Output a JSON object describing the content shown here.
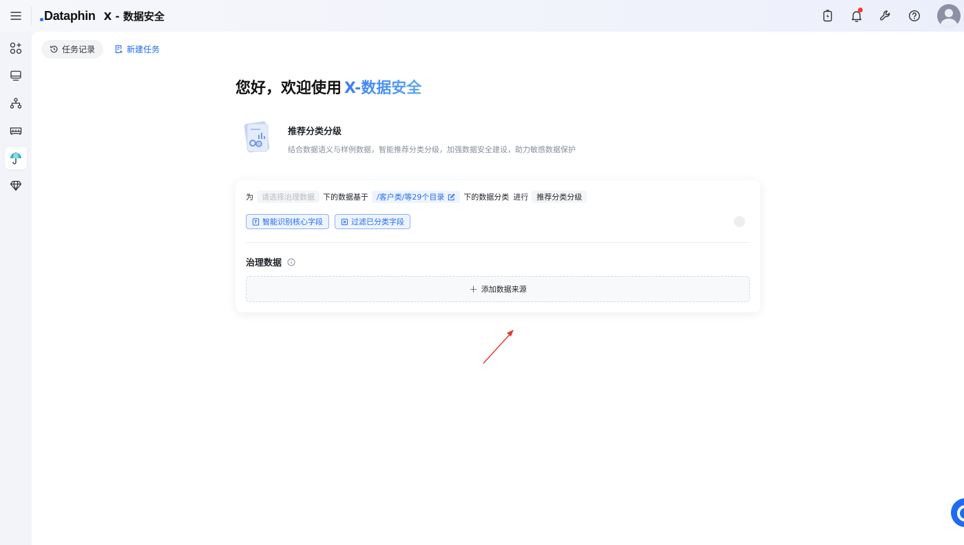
{
  "header": {
    "logo_text": "Dataphin",
    "app_title": "X - 数据安全",
    "icons": [
      "battery-charge-icon",
      "bell-icon",
      "wrench-icon",
      "help-icon",
      "avatar"
    ]
  },
  "sidebar": {
    "items": [
      "apps-icon",
      "monitor-icon",
      "hierarchy-icon",
      "dashboard-icon",
      "umbrella-icon",
      "diamond-icon"
    ],
    "active": "umbrella-icon"
  },
  "tabs": {
    "history_label": "任务记录",
    "new_task_label": "新建任务"
  },
  "welcome": {
    "prefix": "您好，欢迎使用",
    "brand": "X-数据安全"
  },
  "feature": {
    "title": "推荐分类分级",
    "description": "结合数据语义与样例数据，智能推荐分类分级，加强数据安全建设，助力敏感数据保护"
  },
  "prompt": {
    "word_for": "为",
    "data_placeholder": "请选择治理数据",
    "word_based_on": "下的数据基于",
    "catalog_path": "/客户类/等29个目录",
    "word_classification": "下的数据分类",
    "word_perform": "进行",
    "action": "推荐分类分级"
  },
  "options": {
    "identify_core": "智能识别核心字段",
    "filter_classified": "过滤已分类字段"
  },
  "governance": {
    "section_title": "治理数据",
    "add_source_label": "添加数据来源"
  },
  "colors": {
    "accent": "#1f6cf0",
    "brand_gradient_start": "#3b7cf5",
    "brand_gradient_end": "#5aa7ef",
    "notification_dot": "#f23a3a",
    "annotation_arrow": "#e03b32"
  }
}
